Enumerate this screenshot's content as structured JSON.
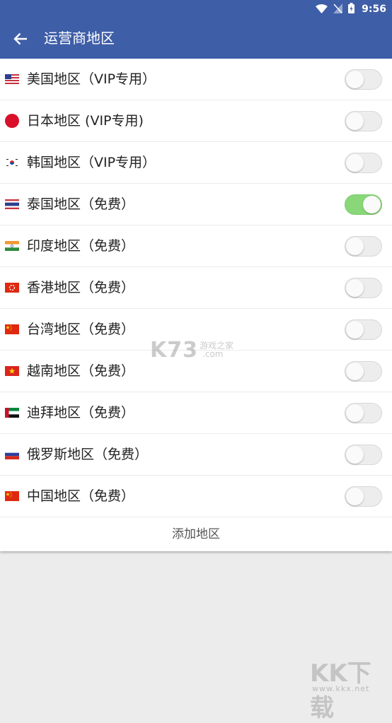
{
  "status": {
    "time": "9:56"
  },
  "appbar": {
    "title": "运营商地区"
  },
  "regions": [
    {
      "label": "美国地区（VIP专用）",
      "flag": "flag-us",
      "enabled": false
    },
    {
      "label": "日本地区 (VIP专用)",
      "flag": "flag-jp",
      "enabled": false
    },
    {
      "label": "韩国地区（VIP专用）",
      "flag": "flag-kr",
      "enabled": false
    },
    {
      "label": "泰国地区（免费）",
      "flag": "flag-th",
      "enabled": true
    },
    {
      "label": "印度地区（免费）",
      "flag": "flag-in",
      "enabled": false
    },
    {
      "label": "香港地区（免费）",
      "flag": "flag-hk",
      "enabled": false
    },
    {
      "label": "台湾地区（免费）",
      "flag": "flag-tw",
      "enabled": false
    },
    {
      "label": "越南地区（免费）",
      "flag": "flag-vn",
      "enabled": false
    },
    {
      "label": "迪拜地区（免费）",
      "flag": "flag-ae",
      "enabled": false
    },
    {
      "label": "俄罗斯地区（免费）",
      "flag": "flag-ru",
      "enabled": false
    },
    {
      "label": "中国地区（免费）",
      "flag": "flag-cn",
      "enabled": false
    }
  ],
  "add_label": "添加地区",
  "watermarks": {
    "mid": "K73",
    "mid_sub": "游戏之家",
    "mid_sub2": ".com",
    "corner": "KK下载",
    "corner_sub": "www.kkx.net"
  },
  "colors": {
    "primary": "#3f5ea8",
    "switch_on": "#8ad77a"
  }
}
